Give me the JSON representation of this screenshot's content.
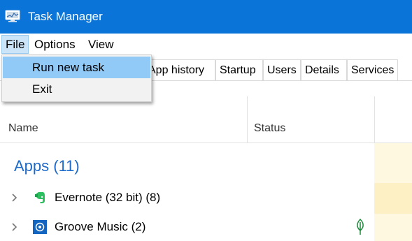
{
  "window": {
    "title": "Task Manager",
    "titlebar_color": "#0a74d8",
    "icon": "task-manager-icon"
  },
  "menubar": {
    "items": [
      {
        "label": "File"
      },
      {
        "label": "Options"
      },
      {
        "label": "View"
      }
    ]
  },
  "file_menu": {
    "items": [
      {
        "label": "Run new task",
        "highlighted": true
      },
      {
        "label": "Exit",
        "highlighted": false
      }
    ],
    "highlight_color": "#91c9f7"
  },
  "tabs": [
    {
      "label": "App history"
    },
    {
      "label": "Startup"
    },
    {
      "label": "Users"
    },
    {
      "label": "Details"
    },
    {
      "label": "Services"
    }
  ],
  "table": {
    "columns": [
      {
        "label": "Name"
      },
      {
        "label": "Status"
      }
    ],
    "groups": [
      {
        "title": "Apps (11)",
        "title_color": "#1e6ac9",
        "rows": [
          {
            "name": "Evernote (32 bit) (8)",
            "icon": "evernote-icon",
            "status_icon": null
          },
          {
            "name": "Groove Music (2)",
            "icon": "groove-music-icon",
            "status_icon": "suspended-leaf-icon"
          }
        ]
      }
    ]
  }
}
